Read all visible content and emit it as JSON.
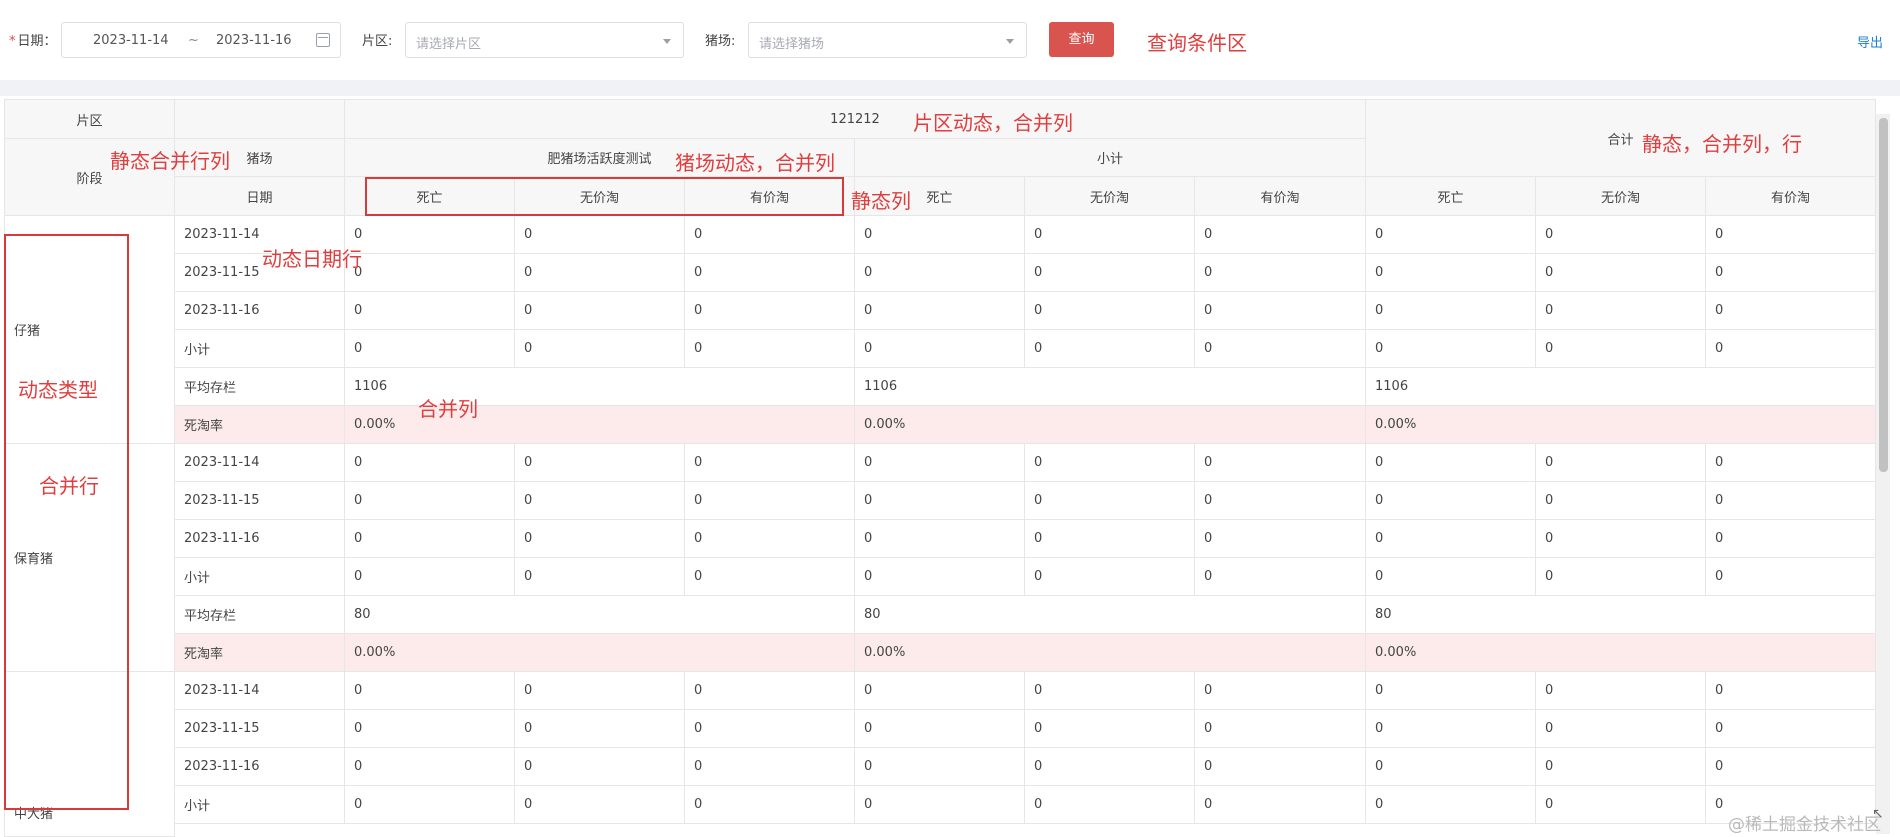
{
  "filters": {
    "date_required_mark": "*",
    "date_label": "日期：",
    "date_start": "2023-11-14",
    "date_sep": "~",
    "date_end": "2023-11-16",
    "area_label": "片区:",
    "area_placeholder": "请选择片区",
    "farm_label": "猪场:",
    "farm_placeholder": "请选择猪场",
    "query_button": "查询",
    "export_link": "导出"
  },
  "annotations": {
    "query_area": "查询条件区",
    "area_dynamic": "片区动态，合并列",
    "static_merge": "静态合并行列",
    "farm_dynamic": "猪场动态，合并列",
    "static_col": "静态列",
    "total_static": "静态，合并列，行",
    "dynamic_date": "动态日期行",
    "dynamic_type": "动态类型",
    "merge_col": "合并列",
    "merge_row": "合并行"
  },
  "table": {
    "header": {
      "area": "片区",
      "area_value": "121212",
      "farm": "猪场",
      "stage": "阶段",
      "date": "日期",
      "farm_name": "肥猪场活跃度测试",
      "subtotal": "小计",
      "total": "合计",
      "metrics": [
        "死亡",
        "无价淘",
        "有价淘"
      ]
    },
    "stages": [
      "仔猪",
      "保育猪",
      "中大猪"
    ],
    "rows": [
      {
        "label": "2023-11-14",
        "values": [
          "0",
          "0",
          "0",
          "0",
          "0",
          "0",
          "0",
          "0",
          "0"
        ]
      },
      {
        "label": "2023-11-15",
        "values": [
          "0",
          "0",
          "0",
          "0",
          "0",
          "0",
          "0",
          "0",
          "0"
        ]
      },
      {
        "label": "2023-11-16",
        "values": [
          "0",
          "0",
          "0",
          "0",
          "0",
          "0",
          "0",
          "0",
          "0"
        ]
      },
      {
        "label": "小计",
        "values": [
          "0",
          "0",
          "0",
          "0",
          "0",
          "0",
          "0",
          "0",
          "0"
        ]
      },
      {
        "label": "平均存栏",
        "values": [
          "1106",
          "1106",
          "1106"
        ]
      },
      {
        "label": "死淘率",
        "values": [
          "0.00%",
          "0.00%",
          "0.00%"
        ]
      },
      {
        "label": "2023-11-14",
        "values": [
          "0",
          "0",
          "0",
          "0",
          "0",
          "0",
          "0",
          "0",
          "0"
        ]
      },
      {
        "label": "2023-11-15",
        "values": [
          "0",
          "0",
          "0",
          "0",
          "0",
          "0",
          "0",
          "0",
          "0"
        ]
      },
      {
        "label": "2023-11-16",
        "values": [
          "0",
          "0",
          "0",
          "0",
          "0",
          "0",
          "0",
          "0",
          "0"
        ]
      },
      {
        "label": "小计",
        "values": [
          "0",
          "0",
          "0",
          "0",
          "0",
          "0",
          "0",
          "0",
          "0"
        ]
      },
      {
        "label": "平均存栏",
        "values": [
          "80",
          "80",
          "80"
        ]
      },
      {
        "label": "死淘率",
        "values": [
          "0.00%",
          "0.00%",
          "0.00%"
        ]
      },
      {
        "label": "2023-11-14",
        "values": [
          "0",
          "0",
          "0",
          "0",
          "0",
          "0",
          "0",
          "0",
          "0"
        ]
      },
      {
        "label": "2023-11-15",
        "values": [
          "0",
          "0",
          "0",
          "0",
          "0",
          "0",
          "0",
          "0",
          "0"
        ]
      },
      {
        "label": "2023-11-16",
        "values": [
          "0",
          "0",
          "0",
          "0",
          "0",
          "0",
          "0",
          "0",
          "0"
        ]
      },
      {
        "label": "小计",
        "values": [
          "0",
          "0",
          "0",
          "0",
          "0",
          "0",
          "0",
          "0",
          "0"
        ]
      }
    ]
  },
  "watermark": "@稀土掘金技术社区",
  "corner_mark": "↖"
}
